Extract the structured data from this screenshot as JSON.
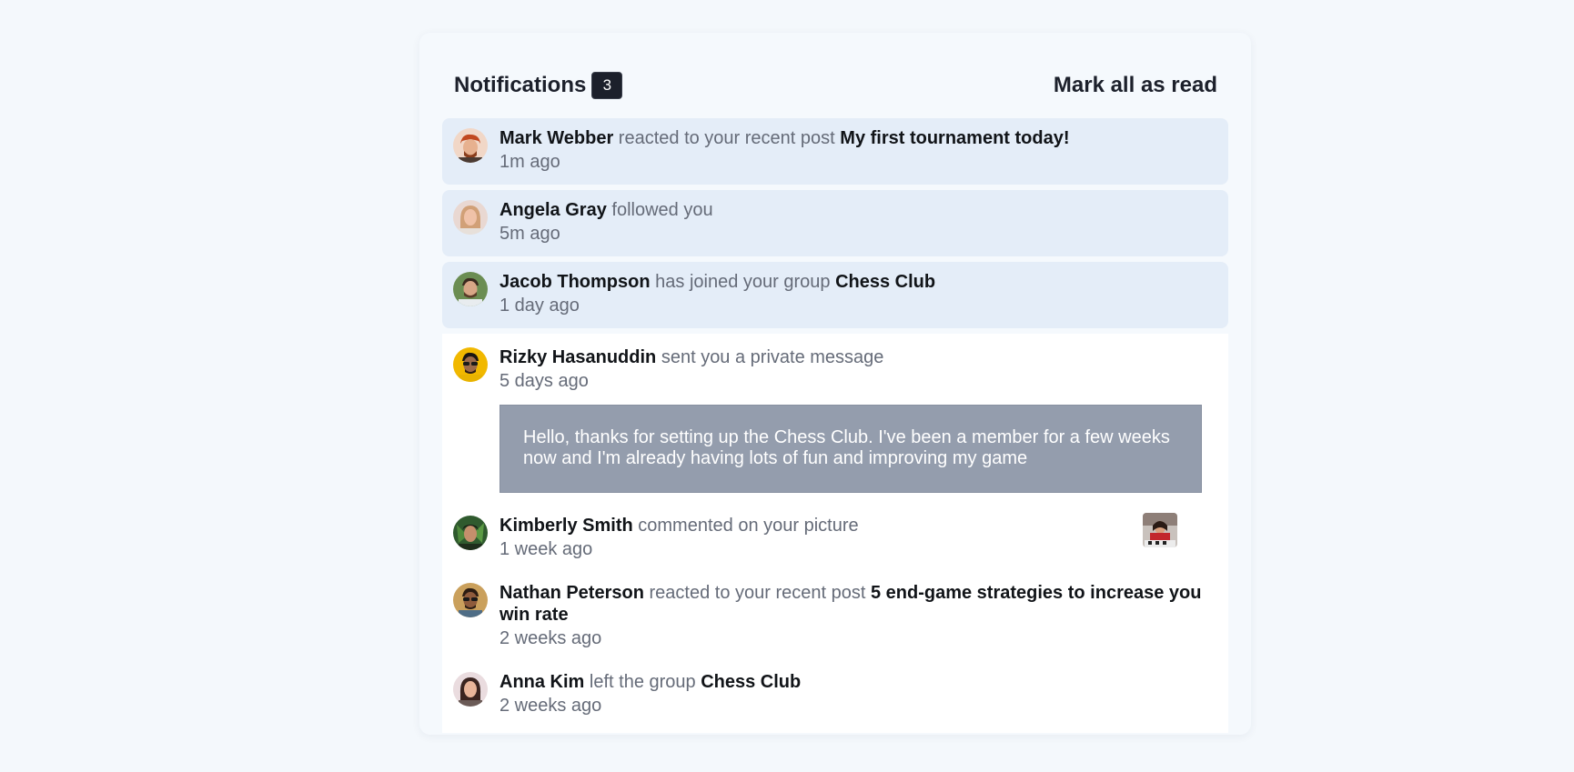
{
  "header": {
    "title": "Notifications",
    "unread_count": "3",
    "mark_all_label": "Mark all as read"
  },
  "colors": {
    "page_bg": "#f4f8fc",
    "unread_bg": "#e4edf8",
    "badge_bg": "#1c202b",
    "message_bg": "#949dad",
    "text_dark": "#111418",
    "text_muted": "#656b78"
  },
  "notifications": [
    {
      "user": "Mark Webber",
      "action": "reacted to your recent post",
      "target": "My first tournament today!",
      "time": "1m ago",
      "unread": true,
      "avatar_icon": "avatar-mark-webber"
    },
    {
      "user": "Angela Gray",
      "action": "followed you",
      "target": "",
      "time": "5m ago",
      "unread": true,
      "avatar_icon": "avatar-angela-gray"
    },
    {
      "user": "Jacob Thompson",
      "action": "has joined your group",
      "target": "Chess Club",
      "time": "1 day ago",
      "unread": true,
      "avatar_icon": "avatar-jacob-thompson"
    },
    {
      "user": "Rizky Hasanuddin",
      "action": "sent you a private message",
      "target": "",
      "time": "5 days ago",
      "unread": false,
      "message": "Hello, thanks for setting up the Chess Club. I've been a member for a few weeks now and I'm already having lots of fun and improving my game",
      "avatar_icon": "avatar-rizky-hasanuddin"
    },
    {
      "user": "Kimberly Smith",
      "action": "commented on your picture",
      "target": "",
      "time": "1 week ago",
      "unread": false,
      "thumbnail_icon": "picture-thumbnail",
      "avatar_icon": "avatar-kimberly-smith"
    },
    {
      "user": "Nathan Peterson",
      "action": "reacted to your recent post",
      "target": "5 end-game strategies to increase you win rate",
      "time": "2 weeks ago",
      "unread": false,
      "avatar_icon": "avatar-nathan-peterson"
    },
    {
      "user": "Anna Kim",
      "action": "left the group",
      "target": "Chess Club",
      "time": "2 weeks ago",
      "unread": false,
      "avatar_icon": "avatar-anna-kim"
    }
  ]
}
